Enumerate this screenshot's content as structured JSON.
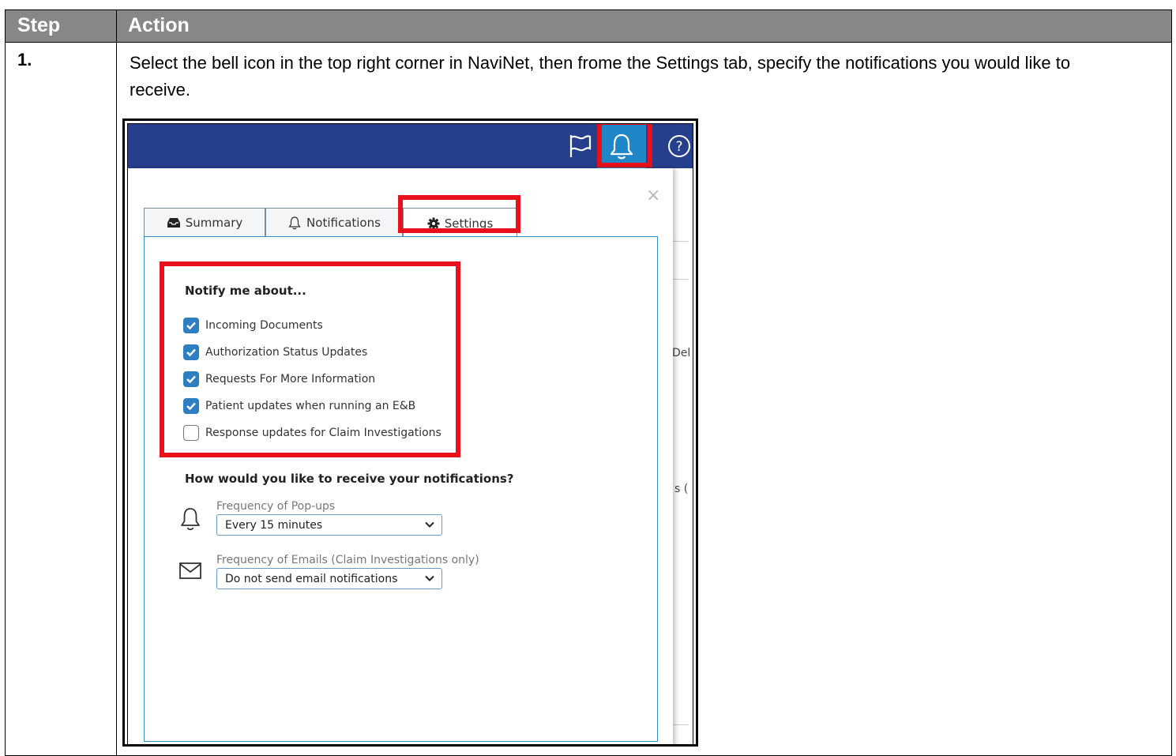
{
  "table": {
    "header_step": "Step",
    "header_action": "Action",
    "rows": [
      {
        "step": "1.",
        "instruction": "Select the bell icon in the top right corner in NaviNet, then frome the Settings tab, specify the notifications you would like to receive."
      }
    ]
  },
  "screenshot": {
    "topbar_color": "#263f8c",
    "topbar_icons": [
      "flag-icon",
      "bell-icon",
      "help-icon"
    ],
    "highlight_color": "#e8101b",
    "background_fragments": [
      "Del",
      "s ("
    ],
    "panel": {
      "close_symbol": "×",
      "tabs": [
        {
          "label": "Summary",
          "icon": "inbox-icon",
          "active": false
        },
        {
          "label": "Notifications",
          "icon": "bell-icon",
          "active": false
        },
        {
          "label": "Settings",
          "icon": "gear-icon",
          "active": true
        }
      ],
      "notify_title": "Notify me about...",
      "notify_options": [
        {
          "label": "Incoming Documents",
          "checked": true
        },
        {
          "label": "Authorization Status Updates",
          "checked": true
        },
        {
          "label": "Requests For More Information",
          "checked": true
        },
        {
          "label": "Patient updates when running an E&B",
          "checked": true
        },
        {
          "label": "Response updates for Claim Investigations",
          "checked": false
        }
      ],
      "receive_title": "How would you like to receive your notifications?",
      "popup_frequency": {
        "label": "Frequency of Pop-ups",
        "value": "Every 15 minutes",
        "icon": "bell-icon"
      },
      "email_frequency": {
        "label": "Frequency of Emails (Claim Investigations only)",
        "value": "Do not send email notifications",
        "icon": "envelope-icon"
      }
    }
  }
}
